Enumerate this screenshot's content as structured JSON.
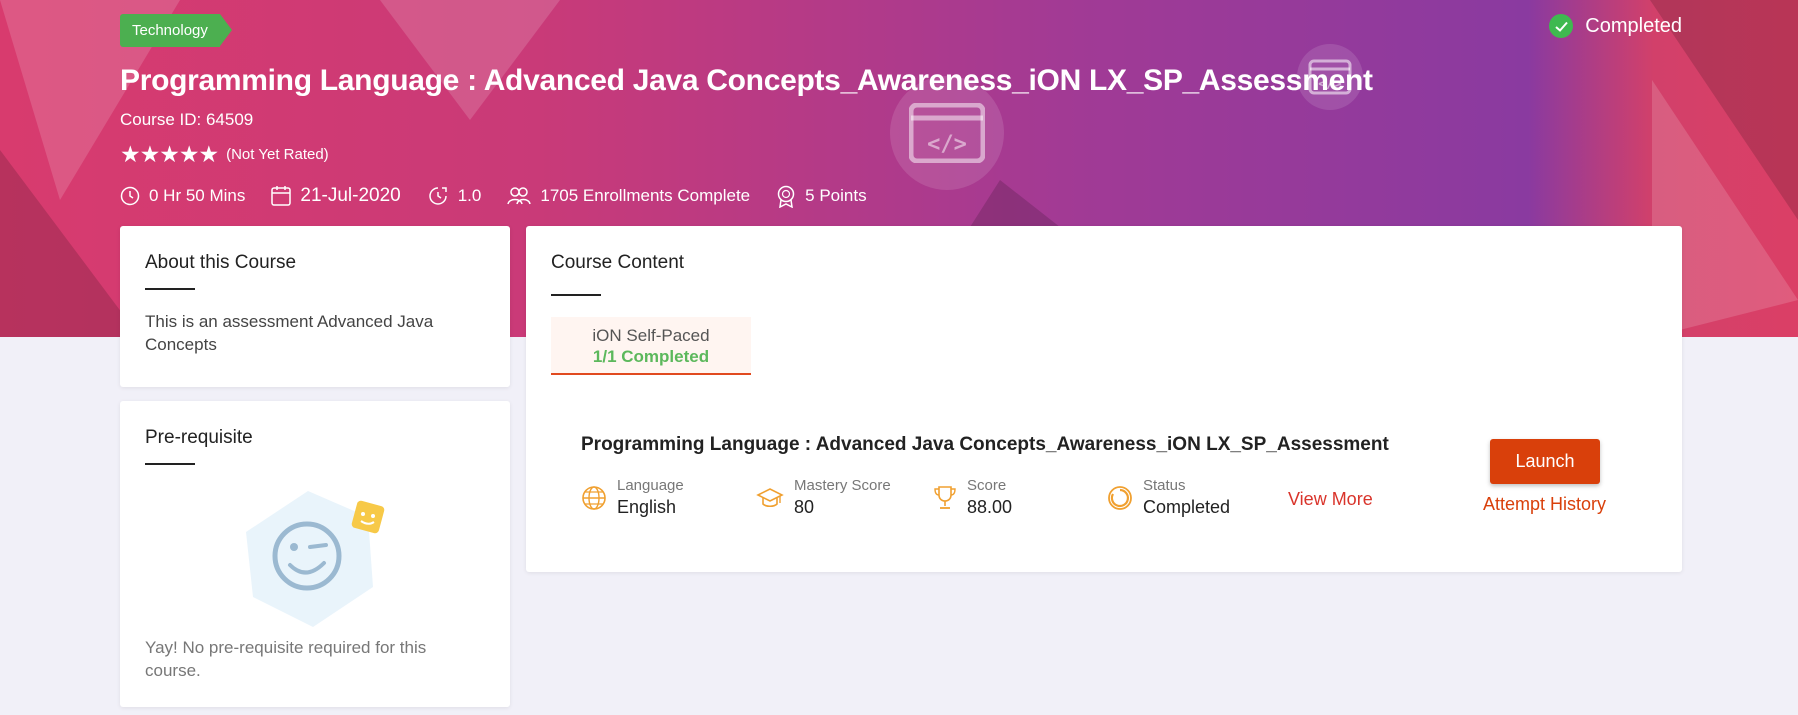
{
  "header": {
    "category_tag": "Technology",
    "status": "Completed",
    "title": "Programming Language : Advanced Java Concepts_Awareness_iON LX_SP_Assessment",
    "course_id": "Course ID: 64509",
    "rating_text": "(Not Yet Rated)",
    "rating_value": 5,
    "duration": "0 Hr 50 Mins",
    "date": "21-Jul-2020",
    "version": "1.0",
    "enrollments": "1705 Enrollments Complete",
    "points": "5 Points"
  },
  "about": {
    "heading": "About this Course",
    "text": "This is an assessment Advanced Java Concepts"
  },
  "prerequisite": {
    "heading": "Pre-requisite",
    "text": "Yay! No pre-requisite required for this course."
  },
  "content": {
    "heading": "Course Content",
    "tab_label": "iON Self-Paced",
    "tab_progress": "1/1 Completed",
    "item": {
      "title": "Programming Language : Advanced Java Concepts_Awareness_iON LX_SP_Assessment",
      "language_label": "Language",
      "language_value": "English",
      "mastery_label": "Mastery Score",
      "mastery_value": "80",
      "score_label": "Score",
      "score_value": "88.00",
      "status_label": "Status",
      "status_value": "Completed",
      "view_more": "View More",
      "launch": "Launch",
      "attempt_history": "Attempt History"
    }
  },
  "colors": {
    "accent": "#d9400b",
    "success": "#4caf50",
    "icon_orange": "#f0a030"
  }
}
